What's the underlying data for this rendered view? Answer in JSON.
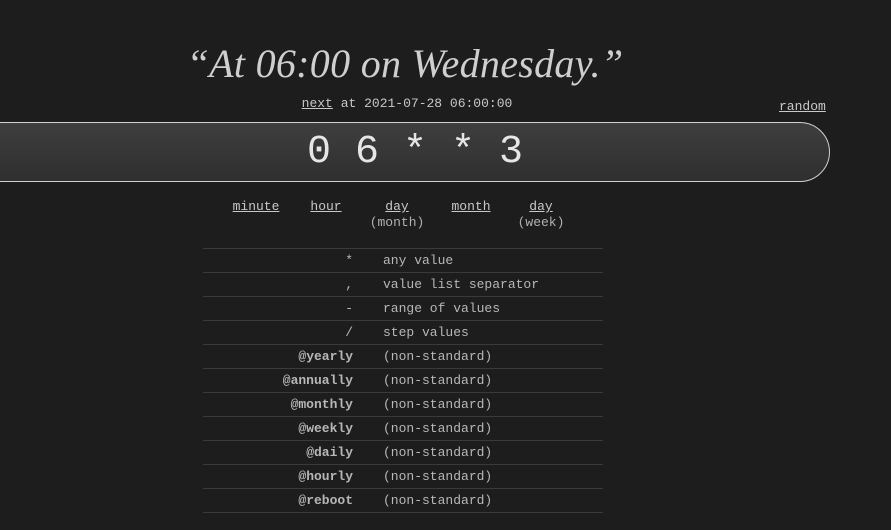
{
  "headline": "“At 06:00 on Wednesday.”",
  "next": {
    "link_label": "next",
    "text": "at 2021-07-28 06:00:00"
  },
  "random_label": "random",
  "expression": "0 6 * * 3",
  "parts": [
    {
      "label": "minute",
      "sub": ""
    },
    {
      "label": "hour",
      "sub": ""
    },
    {
      "label": "day",
      "sub": "(month)"
    },
    {
      "label": "month",
      "sub": ""
    },
    {
      "label": "day",
      "sub": "(week)"
    }
  ],
  "legend": [
    {
      "symbol": "*",
      "desc": "any value"
    },
    {
      "symbol": ",",
      "desc": "value list separator"
    },
    {
      "symbol": "-",
      "desc": "range of values"
    },
    {
      "symbol": "/",
      "desc": "step values"
    },
    {
      "symbol": "@yearly",
      "desc": "(non-standard)"
    },
    {
      "symbol": "@annually",
      "desc": "(non-standard)"
    },
    {
      "symbol": "@monthly",
      "desc": "(non-standard)"
    },
    {
      "symbol": "@weekly",
      "desc": "(non-standard)"
    },
    {
      "symbol": "@daily",
      "desc": "(non-standard)"
    },
    {
      "symbol": "@hourly",
      "desc": "(non-standard)"
    },
    {
      "symbol": "@reboot",
      "desc": "(non-standard)"
    }
  ]
}
